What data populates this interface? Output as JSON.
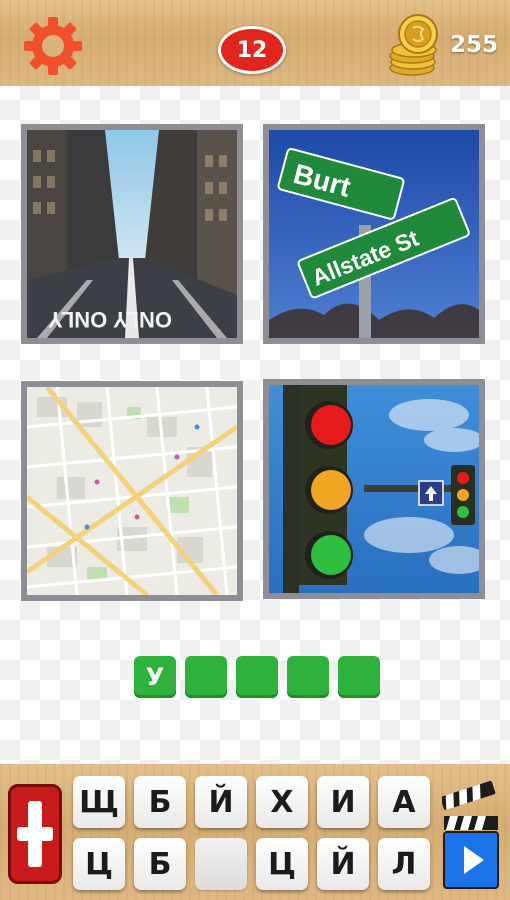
{
  "header": {
    "level": "12",
    "coins": "255",
    "settings_icon": "gear-icon",
    "coins_icon": "coin-stack-icon"
  },
  "pictures": [
    {
      "id": 1,
      "subject": "city-street",
      "road_text": "ONLY ONLY"
    },
    {
      "id": 2,
      "subject": "street-signs",
      "sign_top": "Burt",
      "sign_bottom": "Allstate St"
    },
    {
      "id": 3,
      "subject": "city-map"
    },
    {
      "id": 4,
      "subject": "traffic-lights"
    }
  ],
  "answer": {
    "slots": [
      "У",
      "",
      "",
      "",
      ""
    ],
    "slot_color": "#2fb23c"
  },
  "letters": {
    "row1": [
      "Щ",
      "Б",
      "Й",
      "Х",
      "И",
      "А"
    ],
    "row2": [
      "Ц",
      "Б",
      "",
      "Ц",
      "Й",
      "Л"
    ]
  },
  "buttons": {
    "hint_icon": "plus-icon",
    "video_icon": "clapperboard-play-icon"
  },
  "colors": {
    "level_badge": "#e3261d",
    "gear": "#f0512a",
    "hint_button": "#c91b1b",
    "play_button": "#1a73e8"
  }
}
